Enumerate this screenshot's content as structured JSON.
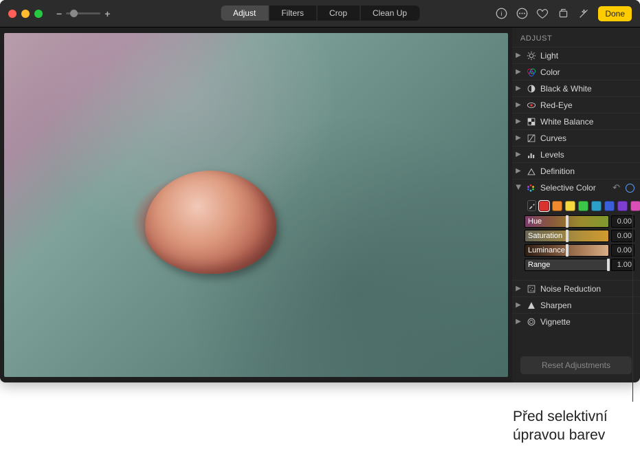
{
  "toolbar": {
    "tabs": [
      "Adjust",
      "Filters",
      "Crop",
      "Clean Up"
    ],
    "active_tab_index": 0,
    "done_label": "Done"
  },
  "sidebar": {
    "header": "ADJUST",
    "items": [
      {
        "label": "Light"
      },
      {
        "label": "Color"
      },
      {
        "label": "Black & White"
      },
      {
        "label": "Red-Eye"
      },
      {
        "label": "White Balance"
      },
      {
        "label": "Curves"
      },
      {
        "label": "Levels"
      },
      {
        "label": "Definition"
      }
    ],
    "selective_color": {
      "label": "Selective Color",
      "swatches": [
        "#d9322f",
        "#f08a2c",
        "#f5d83d",
        "#3cc64a",
        "#2da0c9",
        "#3a5fd9",
        "#7c3fd1",
        "#d94fb6"
      ],
      "sliders": {
        "hue": {
          "label": "Hue",
          "value": "0.00",
          "grad": "linear-gradient(90deg,#7a3d6a,#8a5a3a,#9b8a2e,#7f9a2e)"
        },
        "saturation": {
          "label": "Saturation",
          "value": "0.00",
          "grad": "linear-gradient(90deg,#6a6656,#8a7a4a,#b08f3a,#d19a2e)"
        },
        "luminance": {
          "label": "Luminance",
          "value": "0.00",
          "grad": "linear-gradient(90deg,#2e1f14,#6b4a34,#a87a56,#d9ae86)"
        },
        "range": {
          "label": "Range",
          "value": "1.00",
          "grad": "linear-gradient(90deg,#3a3a3a,#3a3a3a)"
        }
      }
    },
    "items_after": [
      {
        "label": "Noise Reduction"
      },
      {
        "label": "Sharpen"
      },
      {
        "label": "Vignette"
      }
    ],
    "reset_label": "Reset Adjustments"
  },
  "callout": {
    "line1": "Před selektivní",
    "line2": "úpravou barev"
  }
}
